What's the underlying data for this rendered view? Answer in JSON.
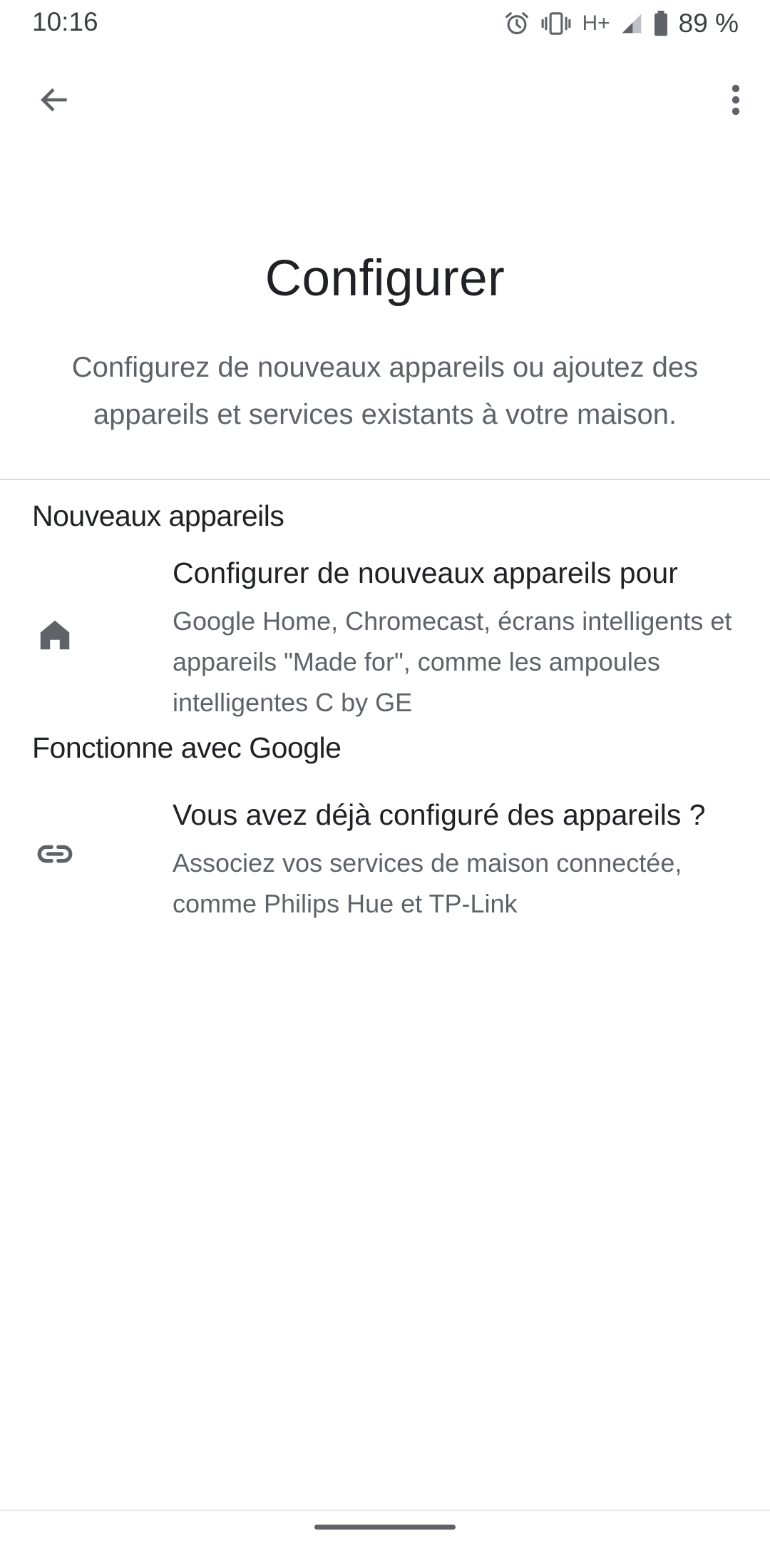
{
  "status_bar": {
    "time": "10:16",
    "network_type": "H+",
    "battery": "89 %",
    "icons": [
      "alarm-icon",
      "vibrate-icon",
      "signal-icon",
      "battery-icon"
    ]
  },
  "app_bar": {
    "back_icon": "arrow-back-icon",
    "more_icon": "more-vert-icon"
  },
  "header": {
    "title": "Configurer",
    "subtitle": "Configurez de nouveaux appareils ou ajoutez des appareils et services existants à votre maison."
  },
  "sections": [
    {
      "heading": "Nouveaux appareils",
      "item": {
        "icon": "home-icon",
        "title": "Configurer de nouveaux appareils pour",
        "description": "Google Home, Chromecast, écrans intelligents et appareils \"Made for\", comme les ampoules intelligentes C by GE"
      }
    },
    {
      "heading": "Fonctionne avec Google",
      "item": {
        "icon": "link-icon",
        "title": "Vous avez déjà configuré des appareils ?",
        "description": "Associez vos services de maison connectée, comme Philips Hue et TP-Link"
      }
    }
  ],
  "colors": {
    "primary_text": "#202124",
    "secondary_text": "#5f6368",
    "icon": "#5f6368",
    "divider": "#dadce0",
    "background": "#ffffff"
  }
}
